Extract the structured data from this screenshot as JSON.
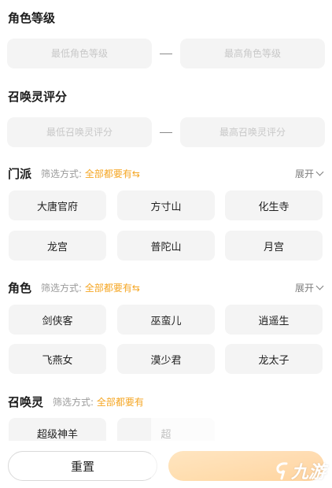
{
  "role_level": {
    "title": "角色等级",
    "min_placeholder": "最低角色等级",
    "max_placeholder": "最高角色等级"
  },
  "pet_score": {
    "title": "召唤灵评分",
    "min_placeholder": "最低召唤灵评分",
    "max_placeholder": "最高召唤灵评分"
  },
  "sect": {
    "label": "门派",
    "mode_label": "筛选方式:",
    "mode_value": "全部都要有",
    "expand": "展开",
    "options": [
      "大唐官府",
      "方寸山",
      "化生寺",
      "龙宫",
      "普陀山",
      "月宫"
    ]
  },
  "role": {
    "label": "角色",
    "mode_label": "筛选方式:",
    "mode_value": "全部都要有",
    "expand": "展开",
    "options": [
      "剑侠客",
      "巫蛮儿",
      "逍遥生",
      "飞燕女",
      "漠少君",
      "龙太子"
    ]
  },
  "pet": {
    "label": "召唤灵",
    "mode_label": "筛选方式:",
    "mode_value": "全部都要有",
    "options": [
      "超级神羊",
      "超"
    ]
  },
  "footer": {
    "reset_label": "重置",
    "watermark": "九游"
  },
  "colors": {
    "accent": "#f5a623",
    "chip_bg": "#f4f4f4",
    "confirm_gradient_start": "#ffb347",
    "confirm_gradient_end": "#ff9a1f"
  },
  "icons": {
    "swap": "swap-arrows-icon",
    "expand": "chevron-down-icon",
    "watermark_logo": "nine-game-logo-icon"
  }
}
